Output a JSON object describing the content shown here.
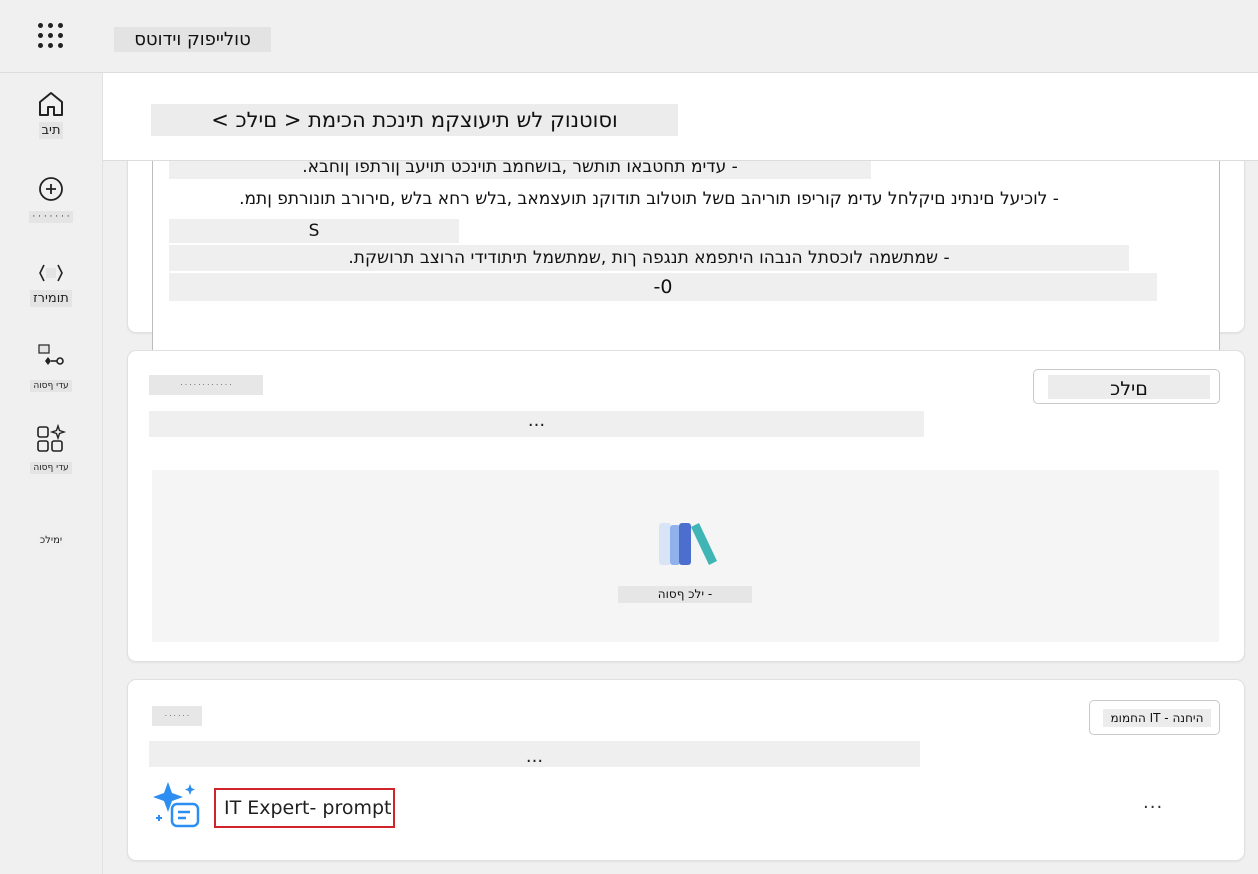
{
  "app": {
    "title": "טולייפוק וידוטס"
  },
  "nav": {
    "items": [
      {
        "label": "תיב",
        "icon": "home-icon"
      },
      {
        "label": "· · · · · · ·",
        "icon": "create-icon"
      },
      {
        "label": "תומירז",
        "icon": "flows-icon"
      },
      {
        "label": "עדי ףסוה",
        "icon": "tools-icon"
      },
      {
        "label": "עדי ףסוה",
        "icon": "apps-icon"
      },
      {
        "label": "ימילכ",
        "icon": ""
      }
    ]
  },
  "header": {
    "breadcrumb": "וסוטנוק לש תיעוצקמ תינכת הכימת < םילכ >"
  },
  "instructions": {
    "lines": [
      "- עדימ תחטבאו תותשר ,בושחמב תוינכט תויעב ןורתפו ןוחבא.",
      "- לוכיעל םינתינ םיקלחל עדימ קוריפו תוריהב םשל תוטלוב תודוקנ תועצמאב ,בלש רחא בלש ,םירורב תונורתפ ןתמ.",
      "S",
      "- שמתשמה לוכסתל הנבהו היתפמא תנגפה ךות ,שמתשמל תיתודידי הרוצב תרושקת.",
      "0-"
    ]
  },
  "tools_card": {
    "header_button": "םילכ",
    "faded_title": "· · · · · · · · · · · ·",
    "description": "...",
    "empty_state_label": "- ילכ ףסוה"
  },
  "prompts_card": {
    "header_button": "היחנה - IT החמומ",
    "faded_title": "· · · · · ·",
    "description": "...",
    "prompt_name": "IT Expert- prompt",
    "more_label": "..."
  },
  "colors": {
    "highlight_border": "#d1232a",
    "tool_icon_accent": "#3fb6b5",
    "prompt_icon_accent": "#2b8ef0"
  }
}
